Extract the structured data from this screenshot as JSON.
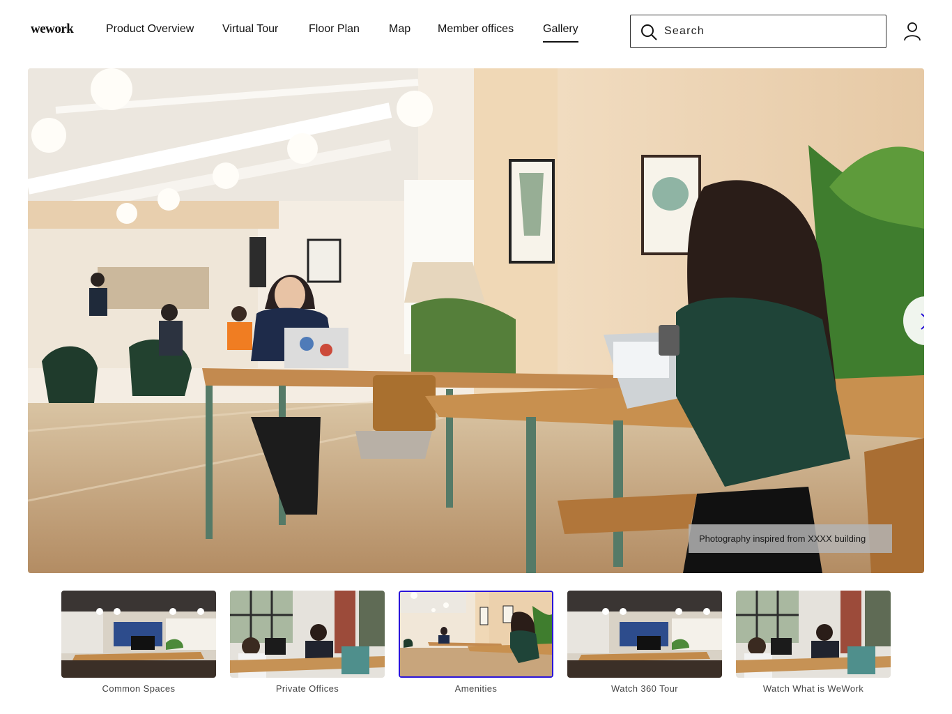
{
  "header": {
    "logo": "wework",
    "nav": [
      {
        "label": "Product Overview",
        "active": false
      },
      {
        "label": "Virtual Tour",
        "active": false
      },
      {
        "label": "Floor Plan",
        "active": false
      },
      {
        "label": "Map",
        "active": false
      },
      {
        "label": "Member offices",
        "active": false
      },
      {
        "label": "Gallery",
        "active": true
      }
    ],
    "search": {
      "placeholder": "Search",
      "value": "",
      "icon": "search-icon"
    },
    "user_icon": "user-icon"
  },
  "hero": {
    "caption": "Photography inspired from XXXX building",
    "next_icon": "chevron-right-icon"
  },
  "thumbnails": [
    {
      "label": "Common Spaces",
      "selected": false
    },
    {
      "label": "Private Offices",
      "selected": false
    },
    {
      "label": "Amenities",
      "selected": true
    },
    {
      "label": "Watch 360 Tour",
      "selected": false
    },
    {
      "label": "Watch What is WeWork",
      "selected": false
    }
  ],
  "colors": {
    "accent": "#2a14d9",
    "text": "#111111",
    "caption_bg": "#b4b4b4"
  }
}
